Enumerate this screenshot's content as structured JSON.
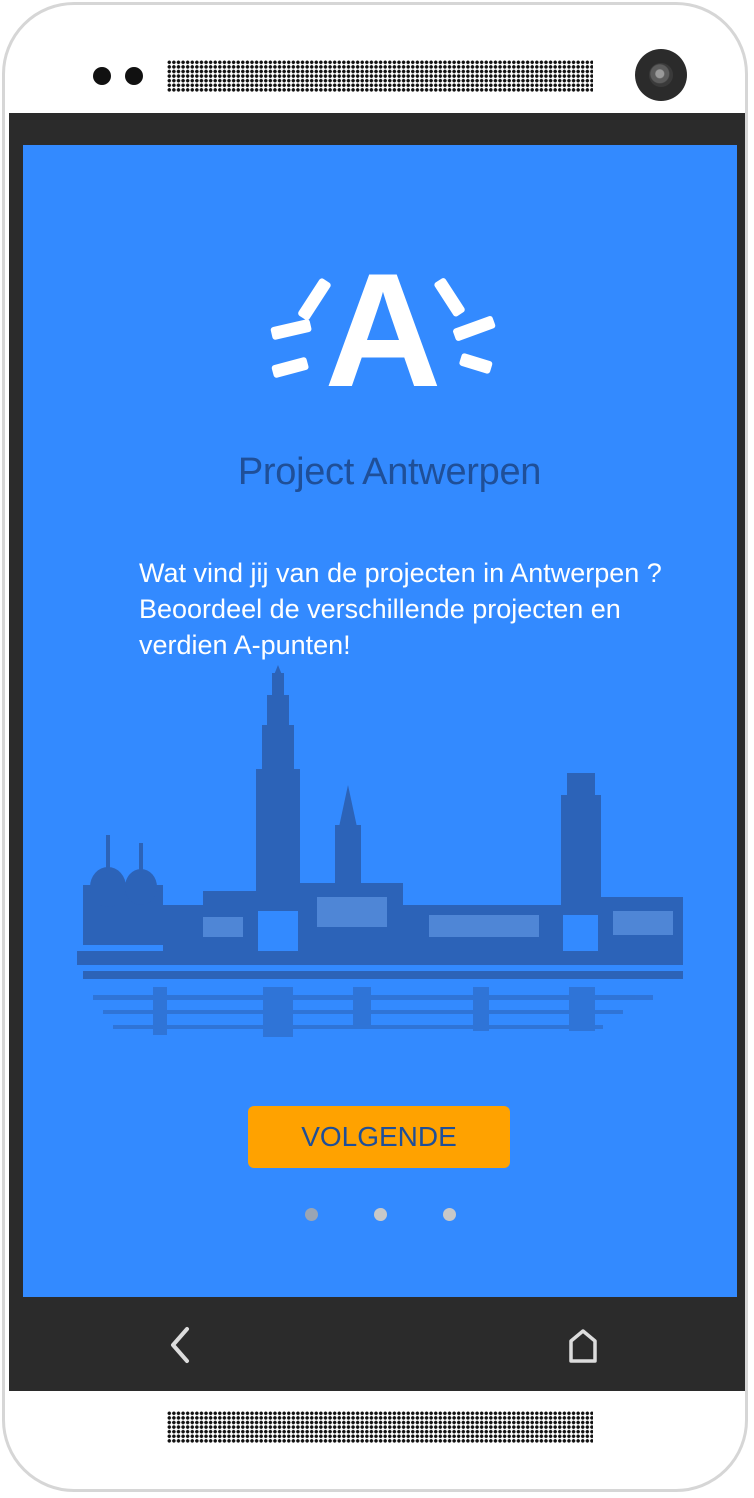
{
  "app": {
    "title": "Project Antwerpen",
    "intro_text": "Wat vind jij van de projecten in Antwerpen ? Beoordeel de verschillende projecten en verdien A-punten!",
    "logo_letter": "A",
    "next_button_label": "VOLGENDE"
  },
  "pager": {
    "page_count": 3,
    "current_page": 1
  },
  "navbar": {
    "back_icon": "chevron-left-icon",
    "home_icon": "home-icon"
  },
  "colors": {
    "screen_background": "#338aff",
    "title_text": "#1f4f98",
    "button_background": "#ffa200",
    "button_text": "#1f4f98",
    "skyline": "#2c63b8",
    "bezel": "#2b2b2b"
  }
}
